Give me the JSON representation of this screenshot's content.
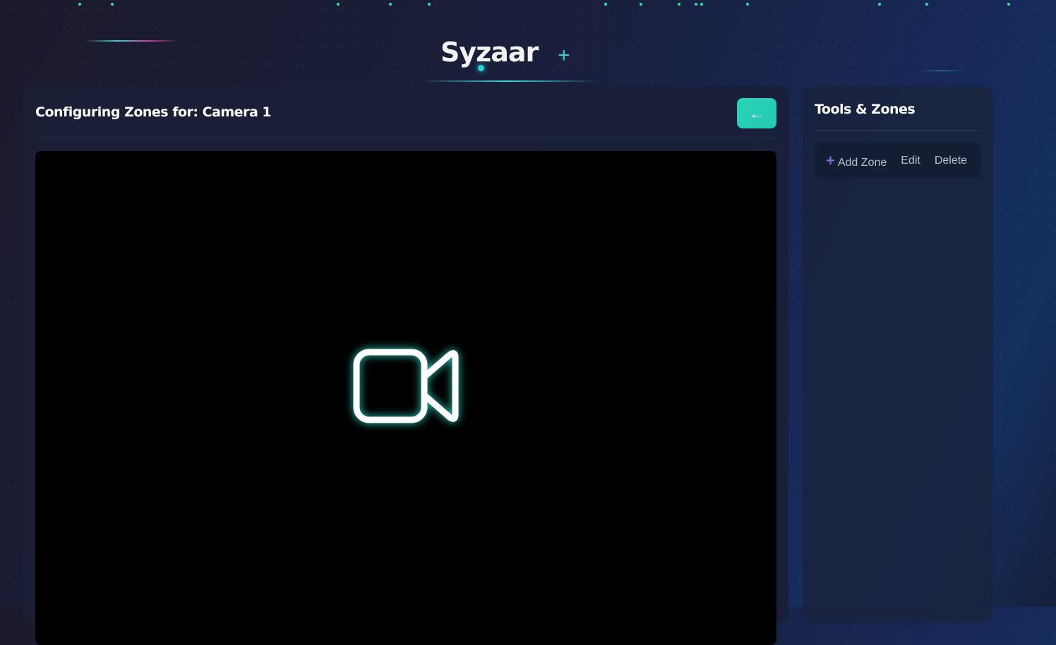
{
  "brand": {
    "name": "Syzaar",
    "mark": "+"
  },
  "main": {
    "title": "Configuring Zones for: Camera 1",
    "back_label": "←"
  },
  "sidebar": {
    "title": "Tools & Zones",
    "add_icon": "+",
    "add_label": "Add Zone",
    "edit_label": "Edit",
    "delete_label": "Delete"
  },
  "colors": {
    "accent": "#2ed3b6",
    "plus": "#8a63d9"
  }
}
